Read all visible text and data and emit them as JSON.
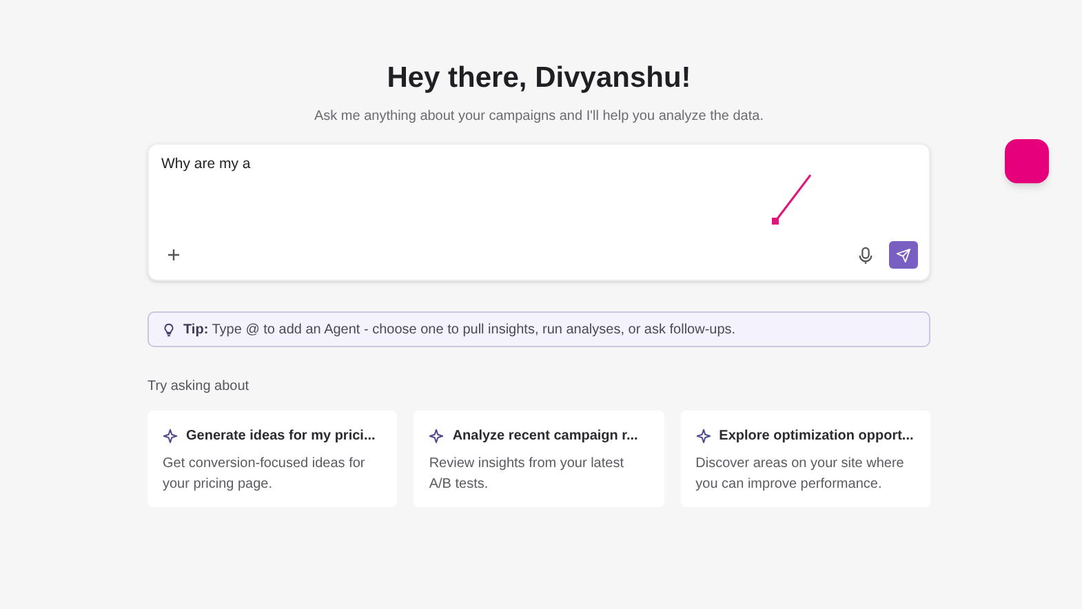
{
  "heading": "Hey there, Divyanshu!",
  "subtitle": "Ask me anything about your campaigns and I'll help you analyze the data.",
  "composer": {
    "value": "Why are my a"
  },
  "tip": "**Tip:** Type @ to add an Agent - choose one to pull insights, run analyses, or ask follow-ups.",
  "suggestions_label": "Try asking about",
  "suggestions": [
    {
      "title": "Generate ideas for my prici...",
      "description": "Get conversion-focused ideas for your pricing page."
    },
    {
      "title": "Analyze recent campaign r...",
      "description": "Review insights from your latest A/B tests."
    },
    {
      "title": "Explore optimization opport...",
      "description": "Discover areas on your site where you can improve performance."
    }
  ]
}
